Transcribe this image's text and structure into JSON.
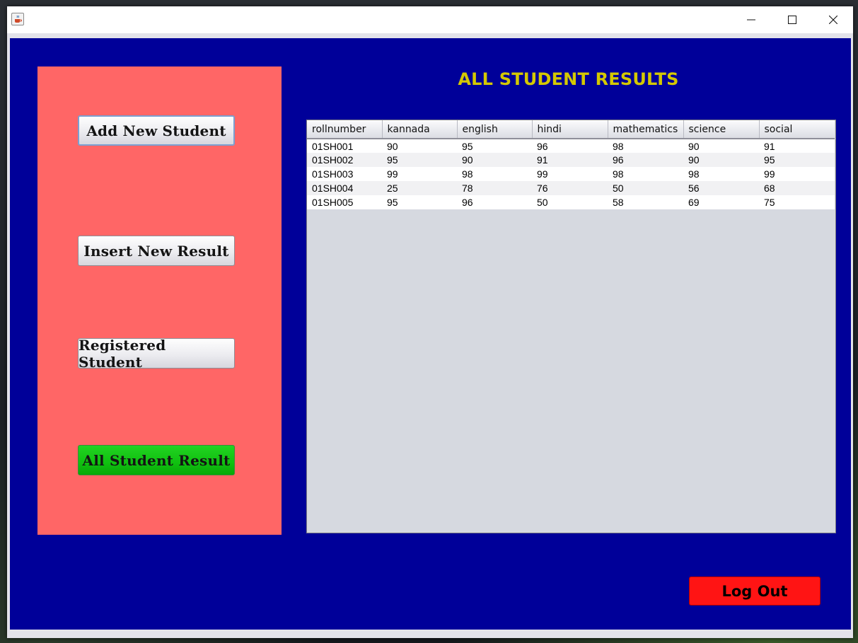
{
  "window": {
    "icon": "java-cup-icon",
    "controls": [
      "minimize-icon",
      "maximize-icon",
      "close-icon"
    ]
  },
  "sidebar": {
    "color": "#ff6666",
    "buttons": [
      {
        "label": "Add New Student"
      },
      {
        "label": "Insert New Result"
      },
      {
        "label": "Registered Student"
      },
      {
        "label": "All Student Result"
      }
    ]
  },
  "main": {
    "title": "ALL STUDENT RESULTS",
    "title_color": "#d4c800",
    "background": "#000099",
    "table": {
      "columns": [
        "rollnumber",
        "kannada",
        "english",
        "hindi",
        "mathematics",
        "science",
        "social"
      ],
      "rows": [
        [
          "01SH001",
          "90",
          "95",
          "96",
          "98",
          "90",
          "91"
        ],
        [
          "01SH002",
          "95",
          "90",
          "91",
          "96",
          "90",
          "95"
        ],
        [
          "01SH003",
          "99",
          "98",
          "99",
          "98",
          "98",
          "99"
        ],
        [
          "01SH004",
          "25",
          "78",
          "76",
          "50",
          "56",
          "68"
        ],
        [
          "01SH005",
          "95",
          "96",
          "50",
          "58",
          "69",
          "75"
        ]
      ]
    },
    "logout_label": "Log Out",
    "logout_color": "#ff1414"
  }
}
